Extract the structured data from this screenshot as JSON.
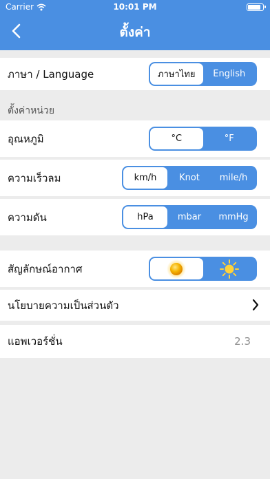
{
  "status_bar": {
    "carrier": "Carrier",
    "time": "10:01 PM"
  },
  "nav": {
    "title": "ตั้งค่า",
    "back_icon": "chevron-left-icon"
  },
  "language": {
    "label": "ภาษา / Language",
    "options": [
      "ภาษาไทย",
      "English"
    ],
    "selected": "ภาษาไทย"
  },
  "units_section_title": "ตั้งค่าหน่วย",
  "temperature": {
    "label": "อุณหภูมิ",
    "options": [
      "°C",
      "°F"
    ],
    "selected": "°C"
  },
  "wind_speed": {
    "label": "ความเร็วลม",
    "options": [
      "km/h",
      "Knot",
      "mile/h"
    ],
    "selected": "km/h"
  },
  "pressure": {
    "label": "ความดัน",
    "options": [
      "hPa",
      "mbar",
      "mmHg"
    ],
    "selected": "hPa"
  },
  "weather_icon": {
    "label": "สัญลักษณ์อากาศ",
    "options": [
      "sun-3d-icon",
      "sun-flat-icon"
    ],
    "selected": "sun-3d-icon"
  },
  "privacy": {
    "label": "นโยบายความเป็นส่วนตัว",
    "icon": "chevron-right-icon"
  },
  "app_version": {
    "label": "แอพเวอร์ชั่น",
    "value": "2.3"
  },
  "colors": {
    "accent": "#4a8fe2",
    "background": "#ececec",
    "sun": "#f5b300"
  }
}
